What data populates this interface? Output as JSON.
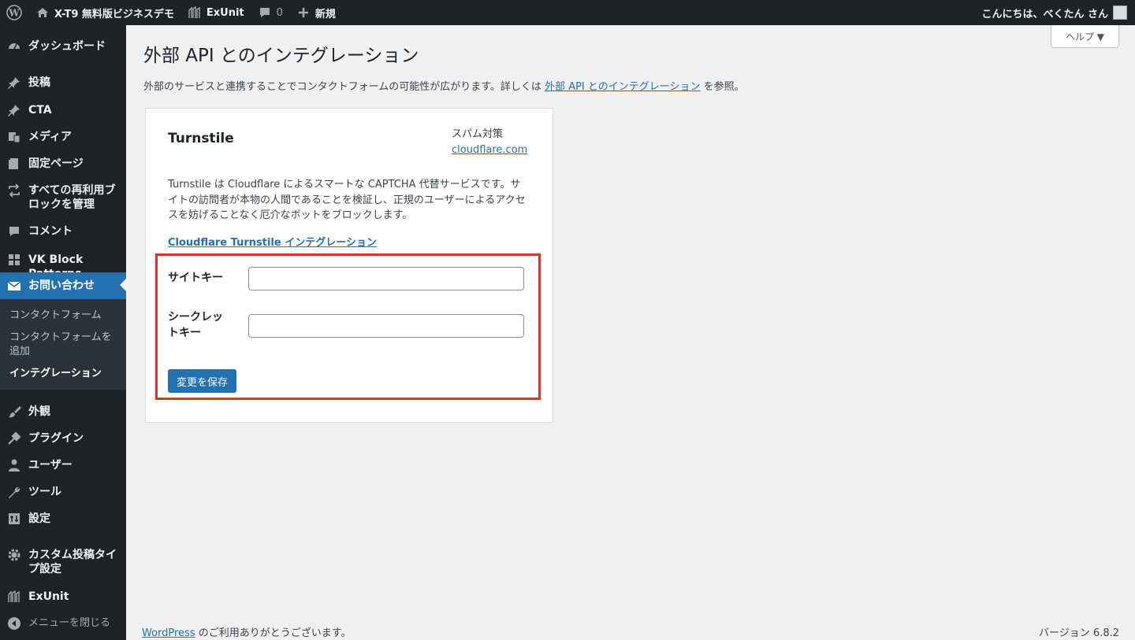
{
  "admin_bar": {
    "site_name": "X-T9 無料版ビジネスデモ",
    "exunit": "ExUnit",
    "comments_count": "0",
    "new_label": "新規",
    "greeting": "こんにちは、べくたん さん"
  },
  "sidebar": {
    "items": [
      {
        "label": "ダッシュボード",
        "icon": "dashboard-icon"
      },
      {
        "label": "投稿",
        "icon": "pin-icon"
      },
      {
        "label": "CTA",
        "icon": "pin-icon"
      },
      {
        "label": "メディア",
        "icon": "media-icon"
      },
      {
        "label": "固定ページ",
        "icon": "page-icon"
      },
      {
        "label": "すべての再利用ブロックを管理",
        "icon": "reuse-icon"
      },
      {
        "label": "コメント",
        "icon": "comment-icon"
      },
      {
        "label": "VK Block Patterns",
        "icon": "grid-icon"
      },
      {
        "label": "お問い合わせ",
        "icon": "mail-icon"
      },
      {
        "label": "外観",
        "icon": "brush-icon"
      },
      {
        "label": "プラグイン",
        "icon": "plugin-icon"
      },
      {
        "label": "ユーザー",
        "icon": "user-icon"
      },
      {
        "label": "ツール",
        "icon": "wrench-icon"
      },
      {
        "label": "設定",
        "icon": "settings-icon"
      },
      {
        "label": "カスタム投稿タイプ設定",
        "icon": "gear-icon"
      },
      {
        "label": "ExUnit",
        "icon": "exunit-icon"
      },
      {
        "label": "メニューを閉じる",
        "icon": "collapse-icon"
      }
    ],
    "submenu": [
      {
        "label": "コンタクトフォーム"
      },
      {
        "label": "コンタクトフォームを追加"
      },
      {
        "label": "インテグレーション"
      }
    ]
  },
  "help_label": "ヘルプ ▼",
  "page": {
    "title": "外部 API とのインテグレーション",
    "intro_before": "外部のサービスと連携することでコンタクトフォームの可能性が広がります。詳しくは ",
    "intro_link": "外部 API とのインテグレーション",
    "intro_after": " を参照。"
  },
  "card": {
    "title": "Turnstile",
    "category": "スパム対策",
    "site_link": "cloudflare.com",
    "description": "Turnstile は Cloudflare によるスマートな CAPTCHA 代替サービスです。サイトの訪問者が本物の人間であることを検証し、正規のユーザーによるアクセスを妨げることなく厄介なボットをブロックします。",
    "integration_link": "Cloudflare Turnstile インテグレーション",
    "site_key_label": "サイトキー",
    "site_key_value": "",
    "secret_key_label": "シークレットキー",
    "secret_key_value": "",
    "save_label": "変更を保存"
  },
  "footer": {
    "wordpress_link": "WordPress",
    "thanks": " のご利用ありがとうございます。",
    "version": "バージョン 6.8.2"
  },
  "colors": {
    "admin_bg": "#1d2327",
    "accent": "#2271b1",
    "highlight": "#e8301c"
  }
}
